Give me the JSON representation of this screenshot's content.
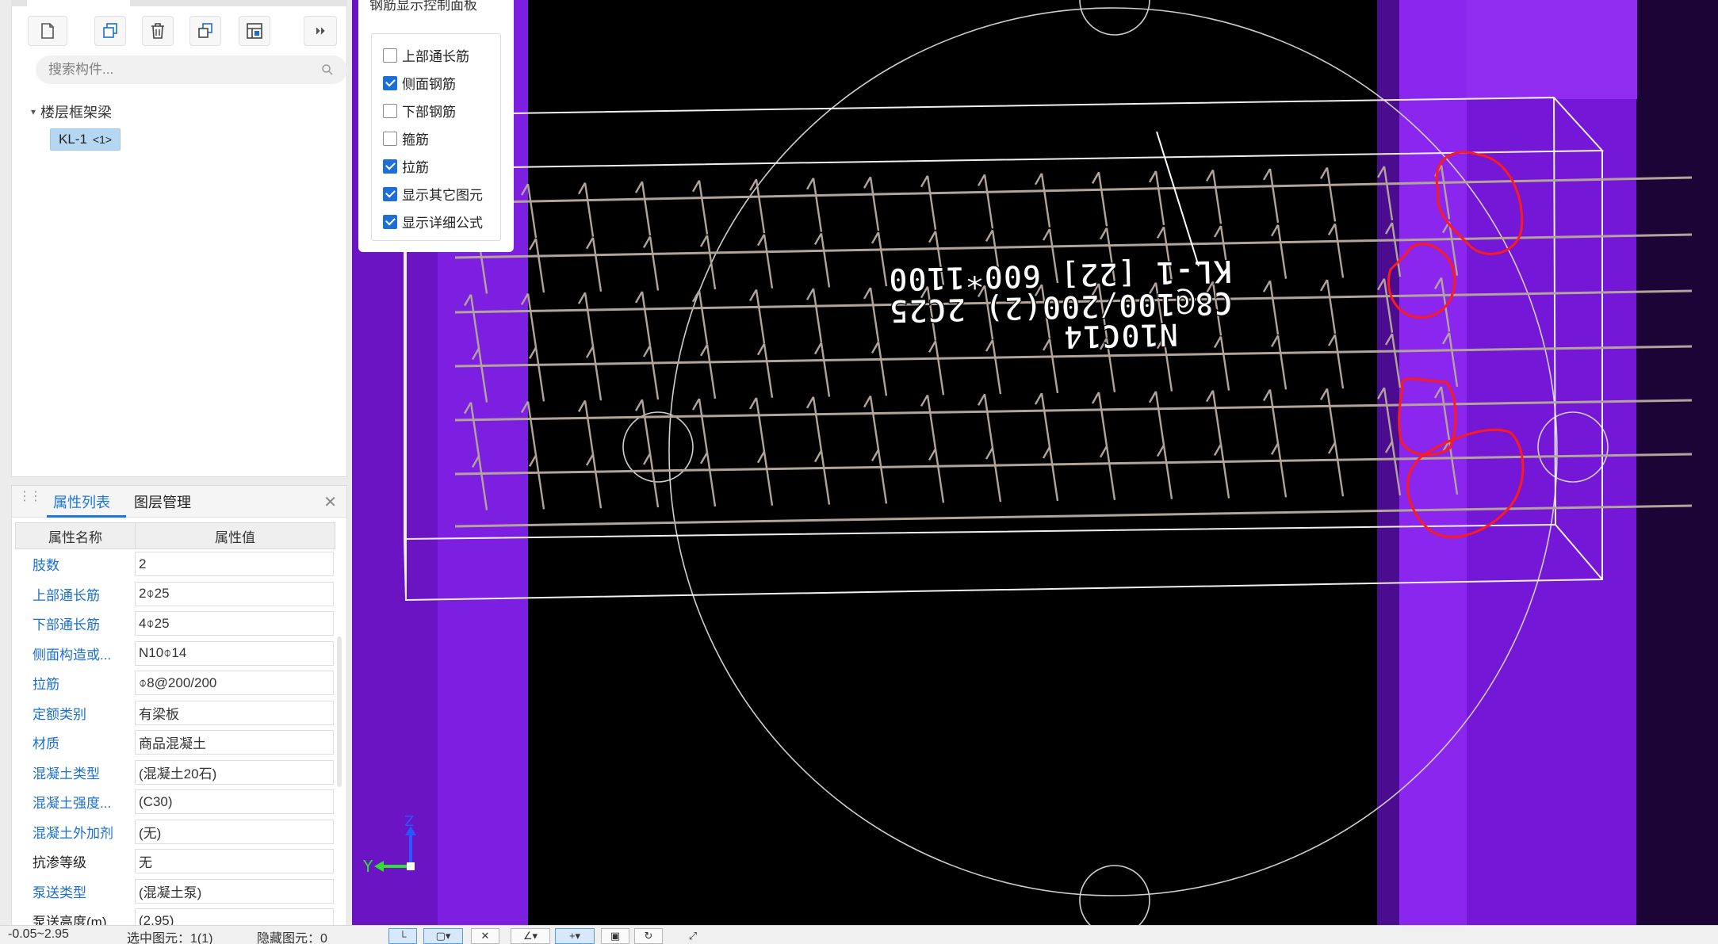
{
  "tree": {
    "search_placeholder": "搜索构件...",
    "root_label": "楼层框架梁",
    "child_label": "KL-1",
    "child_tag": "<1>"
  },
  "display_panel": {
    "title": "钢筋显示控制面板",
    "options": [
      {
        "label": "上部通长筋",
        "checked": false
      },
      {
        "label": "侧面钢筋",
        "checked": true
      },
      {
        "label": "下部钢筋",
        "checked": false
      },
      {
        "label": "箍筋",
        "checked": false
      },
      {
        "label": "拉筋",
        "checked": true
      },
      {
        "label": "显示其它图元",
        "checked": true
      },
      {
        "label": "显示详细公式",
        "checked": true
      }
    ]
  },
  "properties": {
    "tab_props": "属性列表",
    "tab_layers": "图层管理",
    "col_name": "属性名称",
    "col_value": "属性值",
    "rows": [
      {
        "name": "肢数",
        "value": "2",
        "link": true
      },
      {
        "name": "上部通长筋",
        "value": "2⌽25",
        "link": true
      },
      {
        "name": "下部通长筋",
        "value": "4⌽25",
        "link": true
      },
      {
        "name": "侧面构造或...",
        "value": "N10⌽14",
        "link": true
      },
      {
        "name": "拉筋",
        "value": "⌽8@200/200",
        "link": true
      },
      {
        "name": "定额类别",
        "value": "有梁板",
        "link": true
      },
      {
        "name": "材质",
        "value": "商品混凝土",
        "link": true
      },
      {
        "name": "混凝土类型",
        "value": "(混凝土20石)",
        "link": true
      },
      {
        "name": "混凝土强度...",
        "value": "(C30)",
        "link": true
      },
      {
        "name": "混凝土外加剂",
        "value": "(无)",
        "link": true
      },
      {
        "name": "抗渗等级",
        "value": "无",
        "link": false
      },
      {
        "name": "泵送类型",
        "value": "(混凝土泵)",
        "link": true
      },
      {
        "name": "泵送高度(m)",
        "value": "(2.95)",
        "link": false
      }
    ]
  },
  "viewport": {
    "label_line1": "N10C14",
    "label_line2": "C8@100/200(2) 2C25",
    "label_line3": "KL-1 [22] 600*1100",
    "axis_y": "Y",
    "axis_z": "Z",
    "colors": {
      "background": "#000000",
      "column": "#7d1fe0",
      "rebar": "#b3a49a",
      "annotation": "#ff1a1a"
    }
  },
  "status": {
    "elevation": "-0.05~2.95",
    "selected": "选中图元：1(1)",
    "hidden": "隐藏图元：0"
  }
}
